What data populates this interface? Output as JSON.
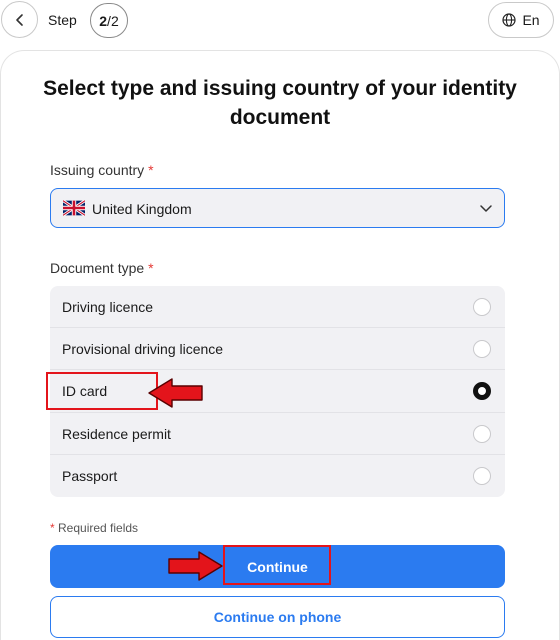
{
  "header": {
    "step_label": "Step",
    "step_current": "2",
    "step_separator": "/",
    "step_total": "2",
    "language": "En"
  },
  "form": {
    "title": "Select type and issuing country of your identity document",
    "country": {
      "label": "Issuing country",
      "required_mark": "*",
      "value": "United Kingdom",
      "flag_icon": "uk-flag-icon"
    },
    "document_type": {
      "label": "Document type",
      "required_mark": "*",
      "selected_index": 2,
      "options": [
        {
          "label": "Driving licence"
        },
        {
          "label": "Provisional driving licence"
        },
        {
          "label": "ID card"
        },
        {
          "label": "Residence permit"
        },
        {
          "label": "Passport"
        }
      ]
    },
    "required_note_mark": "*",
    "required_note": "Required fields",
    "continue_label": "Continue",
    "continue_phone_label": "Continue on phone"
  },
  "colors": {
    "accent": "#2b7bf0",
    "annotation_red": "#e3141b",
    "field_bg": "#f1f1f4"
  }
}
